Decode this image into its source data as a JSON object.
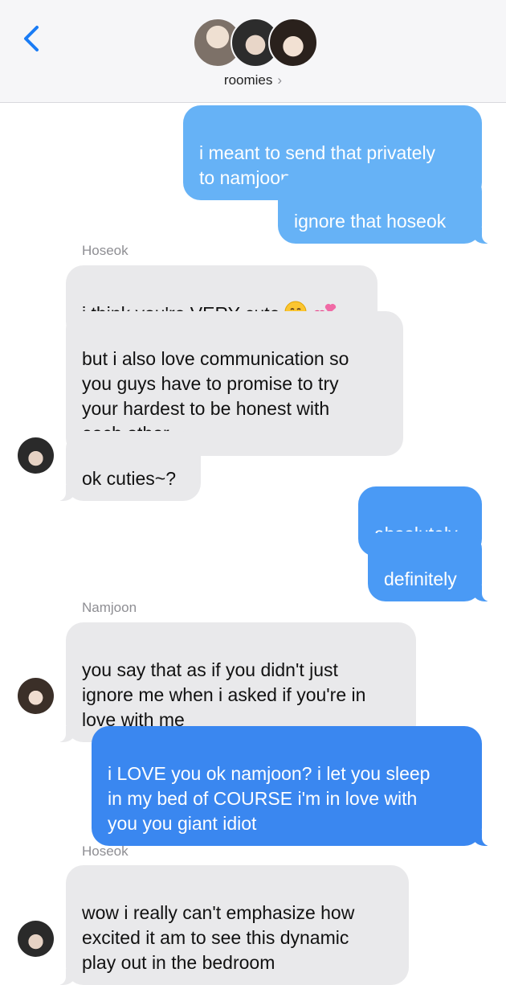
{
  "header": {
    "back_icon": "chevron-left-icon",
    "group_name": "roomies",
    "group_chevron": "›",
    "avatars": [
      "group-avatar-1",
      "group-avatar-2",
      "group-avatar-3"
    ]
  },
  "colors": {
    "outgoing": "#4a9af5",
    "incoming": "#e9e9eb",
    "accent": "#1a7cf5"
  },
  "messages": [
    {
      "dir": "out",
      "text": "i meant to send that privately\nto namjoon"
    },
    {
      "dir": "out",
      "text": "ignore that hoseok"
    },
    {
      "dir": "label",
      "text": "Hoseok"
    },
    {
      "dir": "in",
      "text": "i think you're VERY cute"
    },
    {
      "dir": "in",
      "text": "but i also love communication so\nyou guys have to promise to try\nyour hardest to be honest with\neach other"
    },
    {
      "dir": "in",
      "text": "ok cuties~?"
    },
    {
      "dir": "out",
      "text": "absolutely"
    },
    {
      "dir": "out",
      "text": "definitely"
    },
    {
      "dir": "label",
      "text": "Namjoon"
    },
    {
      "dir": "in",
      "text": "you say that as if you didn't just\nignore me when i asked if you're in\nlove with me"
    },
    {
      "dir": "out",
      "text": "i LOVE you ok namjoon? i let you sleep\nin my bed of COURSE i'm in love with\nyou you giant idiot"
    },
    {
      "dir": "label",
      "text": "Hoseok"
    },
    {
      "dir": "in",
      "text": "wow i really can't emphasize how\nexcited it am to see this dynamic\nplay out in the bedroom"
    }
  ]
}
